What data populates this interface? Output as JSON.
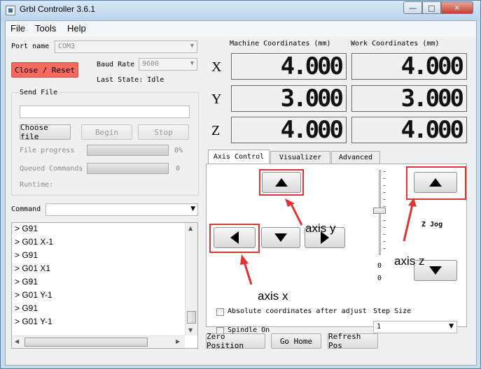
{
  "window": {
    "title": "Grbl Controller 3.6.1",
    "controls": {
      "minimize": "—",
      "maximize": "□",
      "close": "✕"
    }
  },
  "menu": {
    "file": "File",
    "tools": "Tools",
    "help": "Help"
  },
  "left": {
    "port_label": "Port name",
    "port_value": "COM3",
    "baud_label": "Baud Rate",
    "baud_value": "9600",
    "close_reset": "Close / Reset",
    "last_state": "Last State: Idle",
    "send_file_title": "Send File",
    "choose_file": "Choose file",
    "begin": "Begin",
    "stop": "Stop",
    "file_progress_label": "File progress",
    "file_progress_value": "0%",
    "queued_label": "Queued Commands",
    "queued_value": "0",
    "runtime_label": "Runtime:",
    "command_label": "Command",
    "log": [
      "> G91",
      "> G01 X-1",
      "> G91",
      "> G01 X1",
      "> G91",
      "> G01 Y-1",
      "> G91",
      "> G01 Y-1"
    ]
  },
  "coords": {
    "machine_header": "Machine Coordinates (mm)",
    "work_header": "Work Coordinates (mm)",
    "axes": [
      {
        "letter": "X",
        "machine": "4.000",
        "work": "4.000"
      },
      {
        "letter": "Y",
        "machine": "3.000",
        "work": "3.000"
      },
      {
        "letter": "Z",
        "machine": "4.000",
        "work": "4.000"
      }
    ]
  },
  "tabs": {
    "axis_control": "Axis Control",
    "visualizer": "Visualizer",
    "advanced": "Advanced"
  },
  "axis_panel": {
    "z_jog": "Z Jog",
    "slider_val_1": "0",
    "slider_val_2": "0",
    "absolute_coords": "Absolute coordinates after adjust",
    "spindle_on": "Spindle On",
    "step_size_label": "Step Size",
    "step_size_value": "1"
  },
  "annotations": {
    "axis_y": "axis y",
    "axis_x": "axis x",
    "axis_z": "axis z"
  },
  "bottom_buttons": {
    "zero": "Zero Position",
    "home": "Go Home",
    "refresh": "Refresh Pos"
  },
  "colors": {
    "close_reset_bg": "#f46a5f",
    "annotation_red": "#e03434"
  }
}
